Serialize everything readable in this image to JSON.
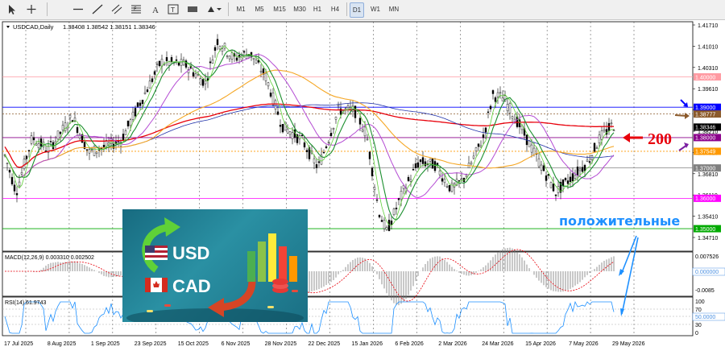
{
  "toolbar": {
    "tools": [
      "cursor-tool",
      "crosshair-tool",
      "horizontal-line-tool",
      "trend-line-tool",
      "channel-tool",
      "fibonacci-tool",
      "text-tool",
      "label-tool",
      "rectangle-tool",
      "shapes-tool"
    ],
    "timeframes": [
      "M1",
      "M5",
      "M15",
      "M30",
      "H1",
      "H4",
      "D1",
      "W1",
      "MN"
    ],
    "active_timeframe": "D1"
  },
  "header": {
    "symbol": "USDCAD,Daily",
    "ohlc": "1.38408 1.38542 1.38151 1.38346"
  },
  "price_scale": [
    "1.41710",
    "1.41010",
    "1.40310",
    "1.39610",
    "1.38910",
    "1.38210",
    "1.37510",
    "1.36810",
    "1.36110",
    "1.35410",
    "1.34710"
  ],
  "levels": [
    {
      "label": "1.40000",
      "color": "#ff9aa2",
      "kind": "line",
      "value": 1.4
    },
    {
      "label": "1.39000",
      "color": "#0000ff",
      "kind": "line",
      "value": 1.39
    },
    {
      "label": "1.38777",
      "color": "#8b5a2b",
      "kind": "dotted",
      "value": 1.38777
    },
    {
      "label": "1.38346",
      "color": "#000000",
      "kind": "current",
      "value": 1.38346
    },
    {
      "label": "1.38000",
      "color": "#8b008b",
      "kind": "line",
      "value": 1.38
    },
    {
      "label": "1.37549",
      "color": "#ff9900",
      "kind": "dotted",
      "value": 1.37549
    },
    {
      "label": "1.37000",
      "color": "#808080",
      "kind": "line",
      "value": 1.37
    },
    {
      "label": "1.36000",
      "color": "#ff00ff",
      "kind": "line",
      "value": 1.36
    },
    {
      "label": "1.35000",
      "color": "#00aa00",
      "kind": "line",
      "value": 1.35
    }
  ],
  "annotations": {
    "ma_label": "200",
    "positive_text": "положительные",
    "ma_color": "#e8000b",
    "text_color": "#1e90ff"
  },
  "macd": {
    "title": "MACD(12,26,9) 0.003310 0.002502",
    "scale": [
      "0.007526",
      "0.000000",
      "-0.0085"
    ]
  },
  "rsi": {
    "title": "RSI(14) 61.9743",
    "scale": [
      "100",
      "70",
      "50.0000",
      "30",
      "0"
    ]
  },
  "time_axis": [
    "17 Jul 2025",
    "8 Aug 2025",
    "1 Sep 2025",
    "23 Sep 2025",
    "15 Oct 2025",
    "6 Nov 2025",
    "28 Nov 2025",
    "22 Dec 2025",
    "15 Jan 2026",
    "6 Feb 2026",
    "2 Mar 2026",
    "24 Mar 2026",
    "15 Apr 2026",
    "7 May 2026",
    "29 May 2026"
  ],
  "promo": {
    "usd_text": "USD",
    "cad_text": "CAD"
  }
}
